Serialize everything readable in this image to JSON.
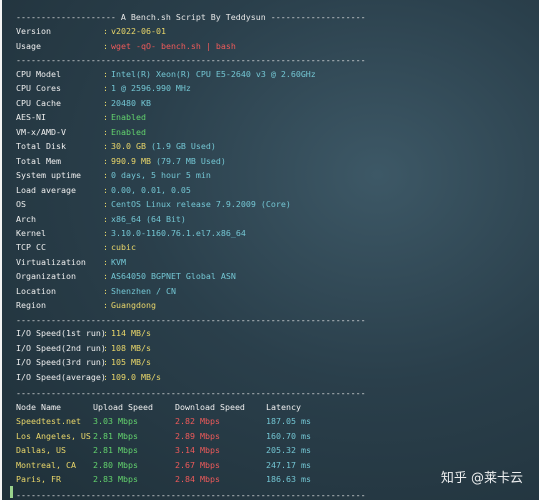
{
  "header": {
    "separator": "-------------------- A Bench.sh Script By Teddysun -------------------"
  },
  "rows1": [
    {
      "label": "Version",
      "value": "v2022-06-01",
      "color": "yellow"
    },
    {
      "label": "Usage",
      "value": "wget -qO- bench.sh | bash",
      "color": "red"
    }
  ],
  "sep_line": "----------------------------------------------------------------------",
  "rows2": [
    {
      "label": "CPU Model",
      "value": "Intel(R) Xeon(R) CPU E5-2640 v3 @ 2.60GHz",
      "color": "cyan"
    },
    {
      "label": "CPU Cores",
      "value": "1 @ 2596.990 MHz",
      "color": "cyan"
    },
    {
      "label": "CPU Cache",
      "value": "20480 KB",
      "color": "cyan"
    },
    {
      "label": "AES-NI",
      "value": "Enabled",
      "color": "green"
    },
    {
      "label": "VM-x/AMD-V",
      "value": "Enabled",
      "color": "green"
    },
    {
      "label": "Total Disk",
      "value": "30.0 GB",
      "extra": " (1.9 GB Used)",
      "color": "yellow",
      "extra_color": "cyan"
    },
    {
      "label": "Total Mem",
      "value": "990.9 MB",
      "extra": " (79.7 MB Used)",
      "color": "yellow",
      "extra_color": "cyan"
    },
    {
      "label": "System uptime",
      "value": "0 days, 5 hour 5 min",
      "color": "cyan"
    },
    {
      "label": "Load average",
      "value": "0.00, 0.01, 0.05",
      "color": "cyan"
    },
    {
      "label": "OS",
      "value": "CentOS Linux release 7.9.2009 (Core)",
      "color": "cyan"
    },
    {
      "label": "Arch",
      "value": "x86_64 (64 Bit)",
      "color": "cyan"
    },
    {
      "label": "Kernel",
      "value": "3.10.0-1160.76.1.el7.x86_64",
      "color": "cyan"
    },
    {
      "label": "TCP CC",
      "value": "cubic",
      "color": "yellow"
    },
    {
      "label": "Virtualization",
      "value": "KVM",
      "color": "cyan"
    },
    {
      "label": "Organization",
      "value": "AS64050 BGPNET Global ASN",
      "color": "cyan"
    },
    {
      "label": "Location",
      "value": "Shenzhen / CN",
      "color": "cyan"
    },
    {
      "label": "Region",
      "value": "Guangdong",
      "color": "yellow"
    }
  ],
  "io": [
    {
      "label": "I/O Speed(1st run)",
      "value": "114 MB/s"
    },
    {
      "label": "I/O Speed(2nd run)",
      "value": "108 MB/s"
    },
    {
      "label": "I/O Speed(3rd run)",
      "value": "105 MB/s"
    },
    {
      "label": "I/O Speed(average)",
      "value": "109.0 MB/s"
    }
  ],
  "speed_headers": [
    "Node Name",
    "Upload Speed",
    "Download Speed",
    "Latency"
  ],
  "speed_rows": [
    {
      "node": "Speedtest.net",
      "up": "3.03 Mbps",
      "down": "2.82 Mbps",
      "lat": "187.05 ms"
    },
    {
      "node": "Los Angeles, US",
      "up": "2.81 Mbps",
      "down": "2.89 Mbps",
      "lat": "160.70 ms"
    },
    {
      "node": "Dallas, US",
      "up": "2.81 Mbps",
      "down": "3.14 Mbps",
      "lat": "205.32 ms"
    },
    {
      "node": "Montreal, CA",
      "up": "2.80 Mbps",
      "down": "2.67 Mbps",
      "lat": "247.17 ms"
    },
    {
      "node": "Paris, FR",
      "up": "2.83 Mbps",
      "down": "2.84 Mbps",
      "lat": "186.63 ms"
    }
  ],
  "watermark": "知乎 @莱卡云",
  "colors": {
    "yellow": "#ead76a",
    "cyan": "#74c7d4",
    "green": "#63d36d",
    "red": "#ef5a5a",
    "background": "#2a3f4b"
  }
}
